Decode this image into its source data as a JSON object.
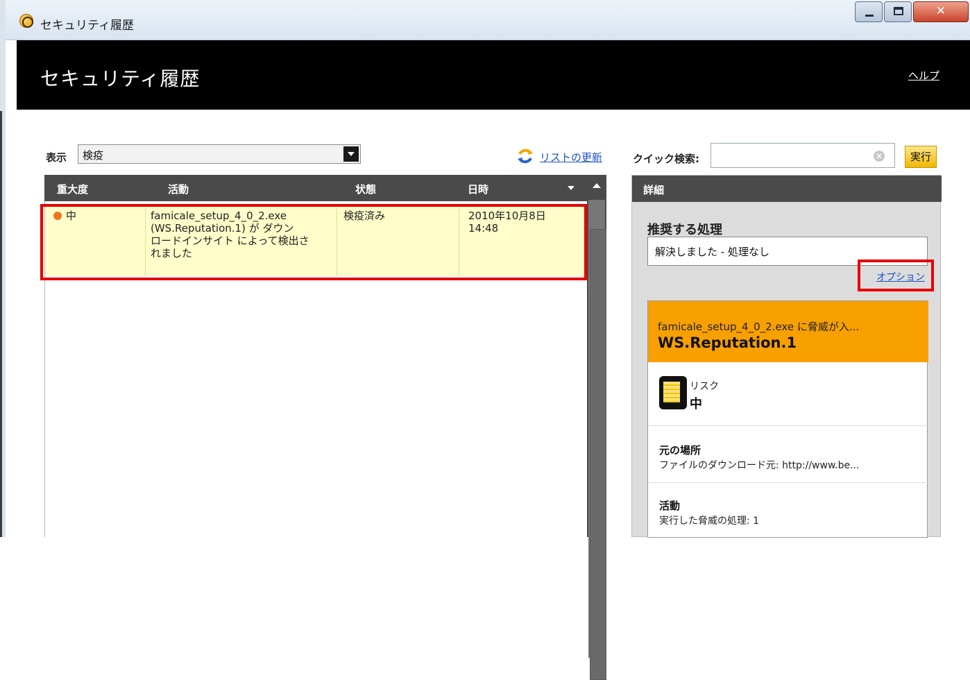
{
  "window": {
    "title": "セキュリティ履歴"
  },
  "header": {
    "title": "セキュリティ履歴",
    "help_link": "ヘルプ"
  },
  "toolbar": {
    "filter_label": "表示",
    "filter_value": "検疫",
    "refresh_label": "リストの更新",
    "quick_search_label": "クイック検索:",
    "quick_search_value": "",
    "go_button": "実行"
  },
  "grid": {
    "columns": [
      "重大度",
      "活動",
      "状態",
      "日時"
    ],
    "rows": [
      {
        "severity": "中",
        "severity_color": "#f0761e",
        "activity_lines": [
          "famicale_setup_4_0_2.exe",
          "(WS.Reputation.1) が ダウン",
          "ロードインサイト によって検出さ",
          "れました"
        ],
        "status": "検疫済み",
        "date_line1": "2010年10月8日",
        "date_line2": "14:48"
      }
    ]
  },
  "details": {
    "header": "詳細",
    "recommended_title": "推奨する処理",
    "recommended_value": "解決しました - 処理なし",
    "options_link": "オプション",
    "threat_file": "famicale_setup_4_0_2.exe に脅威が入...",
    "threat_name": "WS.Reputation.1",
    "risk_label": "リスク",
    "risk_value": "中",
    "origin_title": "元の場所",
    "origin_value": "ファイルのダウンロード元: http://www.be...",
    "activity_title": "活動",
    "activity_value": "実行した脅威の処理: 1"
  },
  "colors": {
    "accent_orange": "#f7a000",
    "highlight_red": "#e60000",
    "selected_row": "#fffdc9"
  }
}
